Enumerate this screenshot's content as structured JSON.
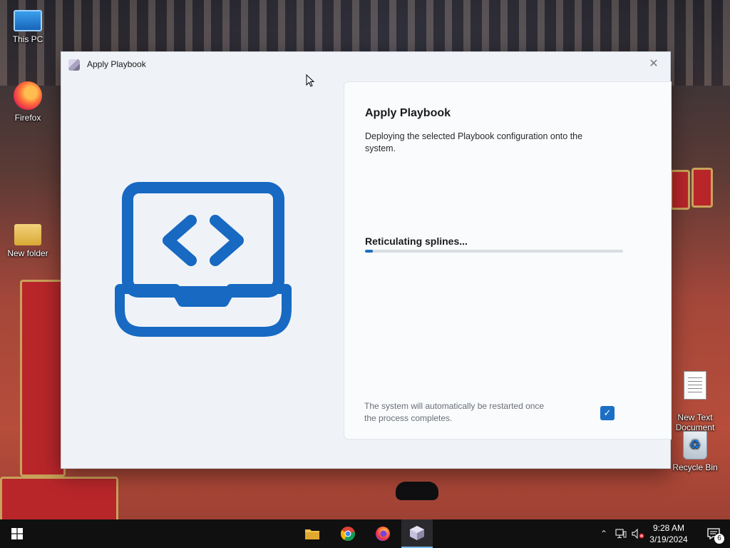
{
  "desktop": {
    "icons": [
      {
        "label": "This PC"
      },
      {
        "label": "Firefox"
      },
      {
        "label": "New folder"
      },
      {
        "label": "New Text\nDocument"
      },
      {
        "label": "Recycle Bin"
      }
    ]
  },
  "window": {
    "title": "Apply Playbook",
    "close_glyph": "✕",
    "art_icon": "laptop-code-icon",
    "panel": {
      "heading": "Apply Playbook",
      "description": "Deploying the selected Playbook configuration onto the system.",
      "status": "Reticulating splines...",
      "progress_percent": 3,
      "restart_note": "The system will automatically be restarted once the process completes.",
      "restart_checked": true,
      "check_glyph": "✓"
    }
  },
  "taskbar": {
    "apps": [
      "file-explorer-icon",
      "chrome-icon",
      "firefox-icon",
      "playbook-app-icon"
    ],
    "active_app": "playbook-app-icon",
    "clock_time": "9:28 AM",
    "clock_date": "3/19/2024",
    "notification_count": "6"
  },
  "colors": {
    "accent": "#1a6fc2",
    "art_blue": "#1769c2"
  }
}
